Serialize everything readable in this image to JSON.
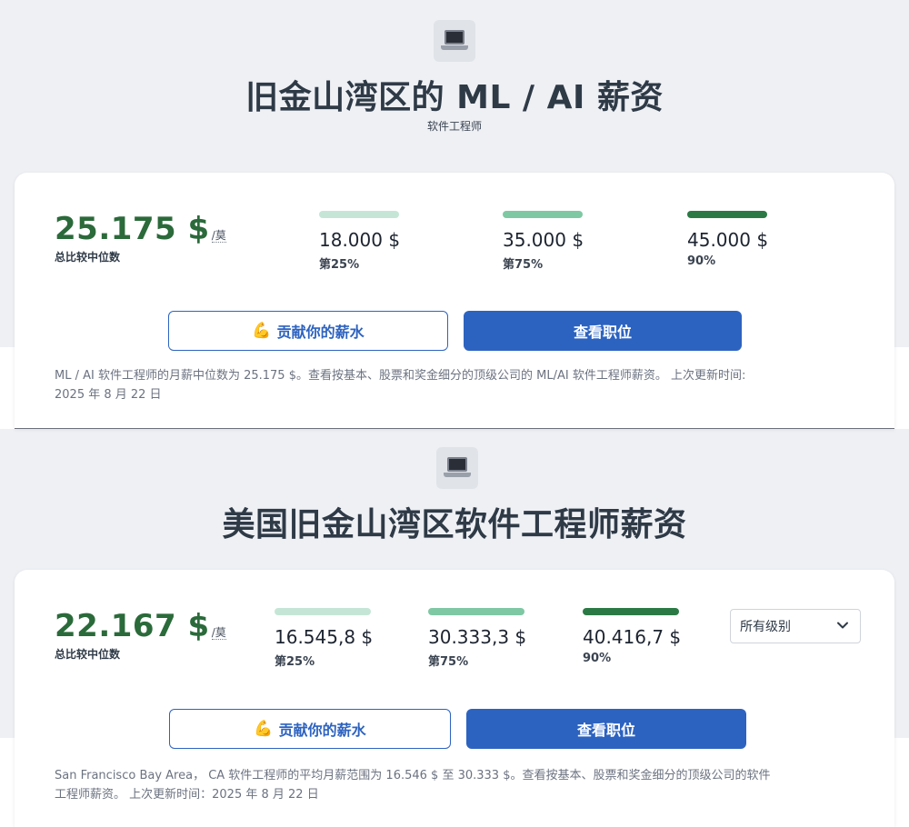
{
  "sections": [
    {
      "title": "旧金山湾区的 ML / AI 薪资",
      "subtitle": "软件工程师",
      "median": {
        "value": "25.175 $",
        "unit": "/莫",
        "label": "总比较中位数"
      },
      "percentiles": [
        {
          "value": "18.000 $",
          "label": "第25%",
          "fraction": 0.25,
          "color": "#c5e6d6"
        },
        {
          "value": "35.000 $",
          "label": "第75%",
          "fraction": 0.75,
          "color": "#7fc8a4"
        },
        {
          "value": "45.000 $",
          "label": "90%",
          "fraction": 0.9,
          "color": "#2b7a45"
        }
      ],
      "contribute_label": "贡献你的薪水",
      "view_jobs_label": "查看职位",
      "description_line1": "ML / AI 软件工程师的月薪中位数为 25.175 $。查看按基本、股票和奖金细分的顶级公司的 ML/AI 软件工程师薪资。 上次更新时间:",
      "description_line2": "2025 年 8 月 22 日"
    },
    {
      "title": "美国旧金山湾区软件工程师薪资",
      "median": {
        "value": "22.167 $",
        "unit": "/莫",
        "label": "总比较中位数"
      },
      "percentiles": [
        {
          "value": "16.545,8 $",
          "label": "第25%",
          "fraction": 0.25,
          "color": "#c5e6d6"
        },
        {
          "value": "30.333,3 $",
          "label": "第75%",
          "fraction": 0.75,
          "color": "#7fc8a4"
        },
        {
          "value": "40.416,7 $",
          "label": "90%",
          "fraction": 0.9,
          "color": "#2b7a45"
        }
      ],
      "level_select": "所有级别",
      "contribute_label": "贡献你的薪水",
      "view_jobs_label": "查看职位",
      "description_line1": "San Francisco Bay Area， CA 软件工程师的平均月薪范围为 16.546 $ 至 30.333 $。查看按基本、股票和奖金细分的顶级公司的软件",
      "description_line2": "工程师薪资。 上次更新时间：2025 年 8 月 22 日"
    }
  ],
  "icons": {
    "header": "laptop-icon",
    "contribute": "flexed-biceps-icon",
    "select": "chevron-down-icon"
  },
  "colors": {
    "brand_blue": "#2d63c0",
    "median_green": "#2b6a3a"
  }
}
